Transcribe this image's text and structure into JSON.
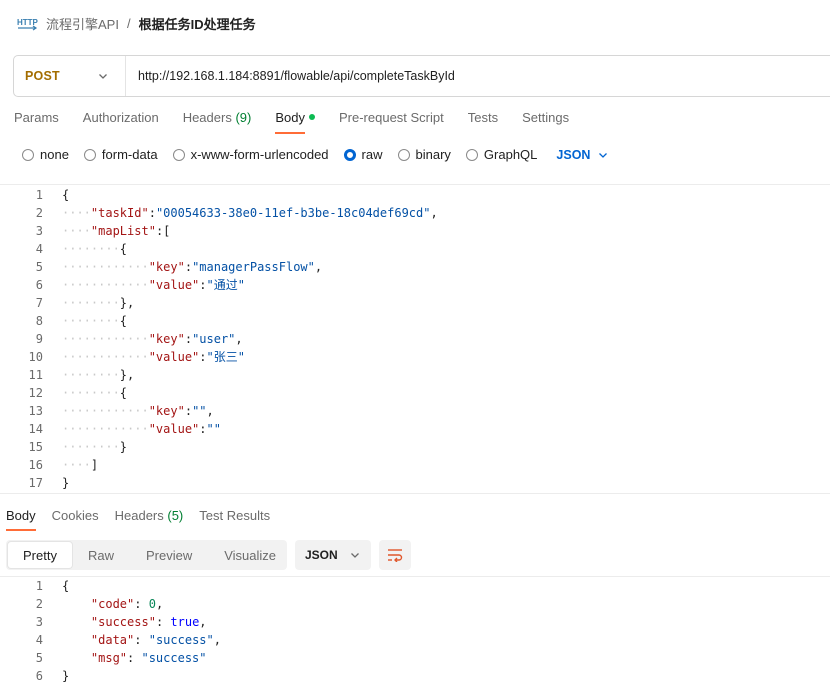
{
  "breadcrumb": {
    "icon": "http-request-icon",
    "parent": "流程引擎API",
    "separator": "/",
    "current": "根据任务ID处理任务"
  },
  "request": {
    "method": "POST",
    "url": "http://192.168.1.184:8891/flowable/api/completeTaskById"
  },
  "request_tabs": [
    {
      "label": "Params",
      "count": ""
    },
    {
      "label": "Authorization",
      "count": ""
    },
    {
      "label": "Headers",
      "count": "(9)"
    },
    {
      "label": "Body",
      "count": "",
      "active": true
    },
    {
      "label": "Pre-request Script",
      "count": ""
    },
    {
      "label": "Tests",
      "count": ""
    },
    {
      "label": "Settings",
      "count": ""
    }
  ],
  "body_types": [
    {
      "label": "none",
      "selected": false
    },
    {
      "label": "form-data",
      "selected": false
    },
    {
      "label": "x-www-form-urlencoded",
      "selected": false
    },
    {
      "label": "raw",
      "selected": true
    },
    {
      "label": "binary",
      "selected": false
    },
    {
      "label": "GraphQL",
      "selected": false
    }
  ],
  "body_format": "JSON",
  "request_body_lines": [
    "{",
    "    \"taskId\":\"00054633-38e0-11ef-b3be-18c04def69cd\",",
    "    \"mapList\":[",
    "        {",
    "            \"key\":\"managerPassFlow\",",
    "            \"value\":\"通过\"",
    "        },",
    "        {",
    "            \"key\":\"user\",",
    "            \"value\":\"张三\"",
    "        },",
    "        {",
    "            \"key\":\"\",",
    "            \"value\":\"\"",
    "        }",
    "    ]",
    "}"
  ],
  "response_tabs": [
    {
      "label": "Body",
      "count": "",
      "active": true
    },
    {
      "label": "Cookies",
      "count": ""
    },
    {
      "label": "Headers",
      "count": "(5)"
    },
    {
      "label": "Test Results",
      "count": ""
    }
  ],
  "response_views": [
    {
      "label": "Pretty",
      "active": true
    },
    {
      "label": "Raw"
    },
    {
      "label": "Preview"
    },
    {
      "label": "Visualize"
    }
  ],
  "response_format": "JSON",
  "response_body_lines": [
    "{",
    "    \"code\": 0,",
    "    \"success\": true,",
    "    \"data\": \"success\",",
    "    \"msg\": \"success\"",
    "}"
  ],
  "colors": {
    "method": "#a36d00",
    "accent_tab": "#ff6c37",
    "radio_selected": "#0265d2",
    "json_key": "#a31515",
    "json_string": "#0451a5",
    "json_number": "#098658",
    "json_bool": "#0000ff",
    "count": "#007f31",
    "body_dot": "#0cbb52"
  }
}
